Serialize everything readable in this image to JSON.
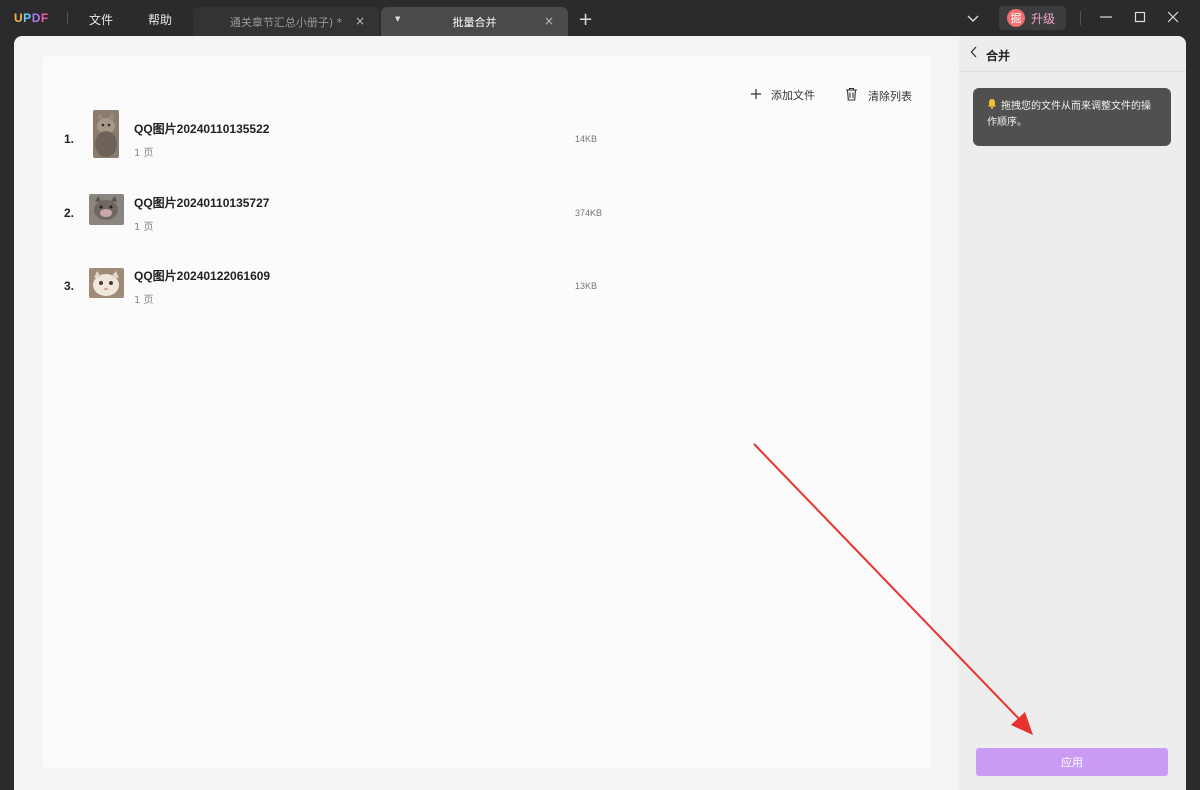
{
  "titlebar": {
    "logo": "UPDF",
    "menu": [
      "文件",
      "帮助"
    ],
    "tabs": [
      {
        "title": "通关章节汇总小册子) *",
        "close": "×"
      },
      {
        "title": "批量合并",
        "close": "×"
      }
    ],
    "add_tab": "+",
    "upgrade": {
      "avatar_text": "掘",
      "label": "升级"
    }
  },
  "toolbar": {
    "add_files": "添加文件",
    "clear_list": "清除列表"
  },
  "files": [
    {
      "index": "1.",
      "name": "QQ图片20240110135522",
      "pages": "1 页",
      "size": "14KB"
    },
    {
      "index": "2.",
      "name": "QQ图片20240110135727",
      "pages": "1 页",
      "size": "374KB"
    },
    {
      "index": "3.",
      "name": "QQ图片20240122061609",
      "pages": "1 页",
      "size": "13KB"
    }
  ],
  "side_panel": {
    "title": "合并",
    "tip": "拖拽您的文件从而来调整文件的操作顺序。",
    "apply_label": "应用"
  },
  "colors": {
    "apply_button": "#c99bf4",
    "annotation_arrow": "#e8322e"
  }
}
